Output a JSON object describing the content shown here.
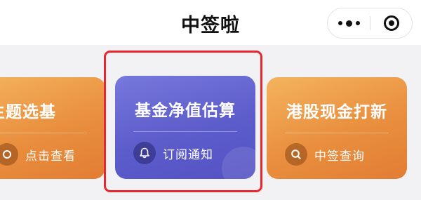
{
  "nav": {
    "title": "中签啦"
  },
  "colors": {
    "highlight": "#e8262b",
    "orange_card": "#e98f3e",
    "purple_card": "#5d5ccb"
  },
  "cards": [
    {
      "title": "门主题选基",
      "action_label": "点击查看",
      "action_icon": "tap-icon",
      "color": "orange"
    },
    {
      "title": "基金净值估算",
      "action_label": "订阅通知",
      "action_icon": "bell-icon",
      "color": "purple",
      "highlighted": true
    },
    {
      "title": "港股现金打新",
      "action_label": "中签查询",
      "action_icon": "search-icon",
      "color": "orange"
    }
  ]
}
